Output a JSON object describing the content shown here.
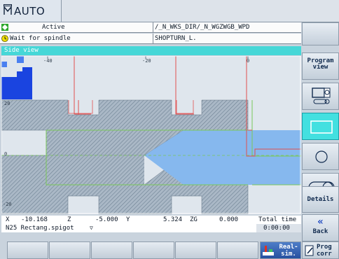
{
  "header": {
    "mode_label": "AUTO",
    "mode_icon": "machine-mode-icon"
  },
  "status": {
    "channel_state": "Active",
    "channel_icon": "channel-active-icon",
    "path": "/_N_WKS_DIR/_N_WGZWGB_WPD",
    "message": "Wait for spindle",
    "message_icon": "wait-clock-icon",
    "program": "SHOPTURN_L."
  },
  "graphic": {
    "title": "Side view",
    "x_ticks": [
      "-40",
      "-20",
      "0"
    ],
    "y_ticks": [
      "20",
      "0",
      "-20"
    ]
  },
  "position": {
    "x_label": "X",
    "x_value": "-10.168",
    "z_label": "Z",
    "z_value": "-5.000",
    "y_label": "Y",
    "y_value": "5.324",
    "zg_label": "ZG",
    "zg_value": "0.000",
    "total_time_label": "Total time",
    "total_time_value": "0:00:00",
    "block": "N25 Rectang.spigot",
    "block_icon": "triangle-down-icon"
  },
  "side_softkeys": [
    {
      "label": ""
    },
    {
      "label": "Program view"
    },
    {
      "label": "",
      "icon": "3d-view-icon"
    },
    {
      "label": "",
      "icon": "side-view-icon",
      "active": true
    },
    {
      "label": "",
      "icon": "face-view-icon"
    },
    {
      "label": "",
      "icon": "cylinder-view-icon"
    },
    {
      "label": "Details"
    },
    {
      "label": "Back",
      "icon": "back-chevron-icon"
    }
  ],
  "bottom_softkeys": [
    {
      "label": ""
    },
    {
      "label": ""
    },
    {
      "label": ""
    },
    {
      "label": ""
    },
    {
      "label": ""
    },
    {
      "label": ""
    },
    {
      "label": "Real- sim.",
      "icon": "real-sim-icon"
    },
    {
      "label": "Prog corr",
      "icon": "prog-corr-icon"
    }
  ],
  "colors": {
    "accent": "#46d7d7",
    "blank": "#7fb8f0",
    "hatch": "#8aa3b8",
    "machined": "#a8c8ee",
    "tool_blue": "#1a44e0",
    "red_line": "#e04848",
    "green_line": "#78d060"
  }
}
